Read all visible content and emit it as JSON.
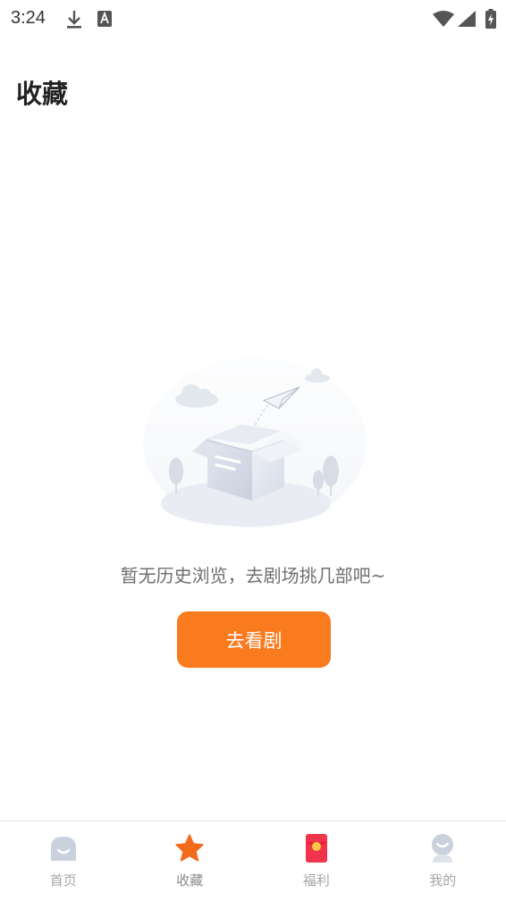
{
  "status_bar": {
    "time": "3:24"
  },
  "page": {
    "title": "收藏"
  },
  "empty_state": {
    "message": "暂无历史浏览，去剧场挑几部吧~",
    "cta_label": "去看剧"
  },
  "bottom_nav": {
    "items": [
      {
        "label": "首页",
        "icon": "home-icon",
        "active": false
      },
      {
        "label": "收藏",
        "icon": "star-icon",
        "active": true
      },
      {
        "label": "福利",
        "icon": "red-envelope-icon",
        "active": false
      },
      {
        "label": "我的",
        "icon": "profile-icon",
        "active": false
      }
    ]
  },
  "colors": {
    "accent": "#fa7a1e",
    "title": "#222222",
    "muted_text": "#6f6f6f",
    "nav_label": "#a5a5a5",
    "red_envelope": "#f0344b"
  }
}
